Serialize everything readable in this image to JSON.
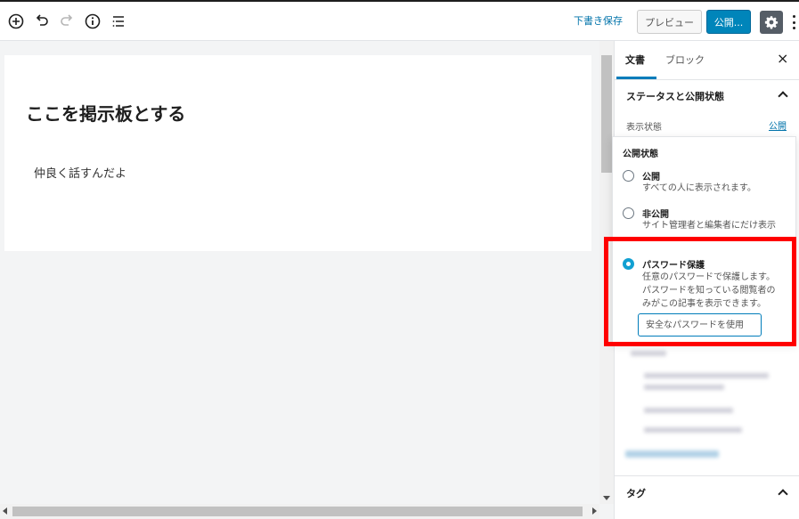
{
  "toolbar": {
    "draft_label": "下書き保存",
    "preview_label": "プレビュー",
    "publish_label": "公開...",
    "icons": [
      "add-block-icon",
      "undo-icon",
      "redo-icon",
      "info-icon",
      "list-view-icon",
      "gear-icon",
      "more-vertical-icon"
    ]
  },
  "editor": {
    "title": "ここを掲示板とする",
    "body": "仲良く話すんだよ"
  },
  "sidebar": {
    "tabs": [
      {
        "label": "文書"
      },
      {
        "label": "ブロック"
      }
    ],
    "close_label": "×",
    "status_panel": {
      "title": "ステータスと公開状態",
      "visibility_label": "表示状態",
      "visibility_value": "公開"
    },
    "tag_panel": {
      "title": "タグ"
    }
  },
  "visibility_popover": {
    "title": "公開状態",
    "options": [
      {
        "label": "公開",
        "desc": [
          "すべての人に表示されます。"
        ],
        "selected": false
      },
      {
        "label": "非公開",
        "desc": [
          "サイト管理者と編集者にだけ表示"
        ],
        "selected": false
      },
      {
        "label": "パスワード保護",
        "desc": [
          "任意のパスワードで保護します。",
          "パスワードを知っている閲覧者の",
          "みがこの記事を表示できます。"
        ],
        "selected": true
      }
    ],
    "password_placeholder": "安全なパスワードを使用"
  },
  "colors": {
    "accent": "#007cba",
    "publish": "#0085ba",
    "highlight": "#ff0000",
    "radio_checked": "#11a0d2"
  }
}
